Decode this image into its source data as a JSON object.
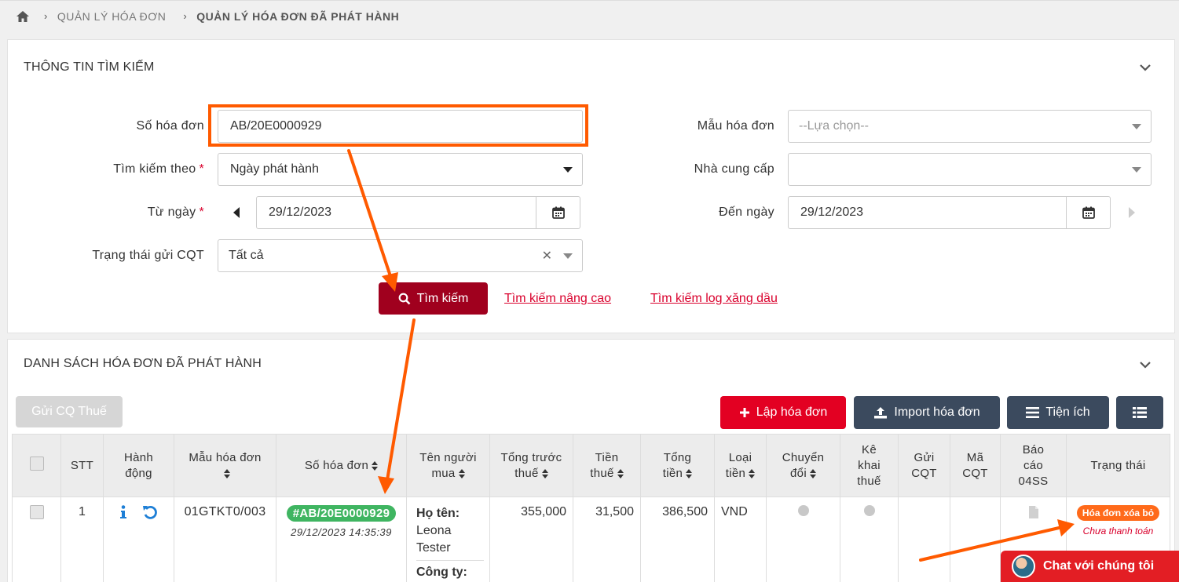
{
  "breadcrumb": {
    "items": [
      "QUẢN LÝ HÓA ĐƠN",
      "QUẢN LÝ HÓA ĐƠN ĐÃ PHÁT HÀNH"
    ]
  },
  "search_panel": {
    "title": "THÔNG TIN TÌM KIẾM",
    "invoice_number_label": "Số hóa đơn",
    "invoice_number_value": "AB/20E0000929",
    "search_by_label": "Tìm kiếm theo",
    "search_by_value": "Ngày phát hành",
    "from_date_label": "Từ ngày",
    "from_date_value": "29/12/2023",
    "status_label": "Trạng thái gửi CQT",
    "status_value": "Tất cả",
    "template_label": "Mẫu hóa đơn",
    "template_placeholder": "--Lựa chọn--",
    "supplier_label": "Nhà cung cấp",
    "supplier_value": "",
    "to_date_label": "Đến ngày",
    "to_date_value": "29/12/2023",
    "search_button": "Tìm kiếm",
    "advanced_search_link": "Tìm kiếm nâng cao",
    "fuel_log_link": "Tìm kiếm log xăng dầu",
    "required_mark": "*"
  },
  "list_panel": {
    "title": "DANH SÁCH HÓA ĐƠN ĐÃ PHÁT HÀNH",
    "send_tax_button": "Gửi CQ Thuế",
    "create_invoice_button": "Lập hóa đơn",
    "import_invoice_button": "Import hóa đơn",
    "utilities_button": "Tiện ích"
  },
  "table": {
    "headers": {
      "stt": "STT",
      "action": [
        "Hành",
        "động"
      ],
      "template": "Mẫu hóa đơn",
      "number": "Số hóa đơn",
      "buyer": [
        "Tên người",
        "mua"
      ],
      "pretax": [
        "Tổng trước",
        "thuế"
      ],
      "tax": [
        "Tiền",
        "thuế"
      ],
      "total": [
        "Tổng",
        "tiền"
      ],
      "currency": [
        "Loại",
        "tiền"
      ],
      "convert": [
        "Chuyển",
        "đổi"
      ],
      "declare": [
        "Kê",
        "khai",
        "thuế"
      ],
      "send": [
        "Gửi",
        "CQT"
      ],
      "code": [
        "Mã",
        "CQT"
      ],
      "report": [
        "Báo",
        "cáo",
        "04SS"
      ],
      "status": "Trạng thái"
    },
    "rows": [
      {
        "stt": "1",
        "template": "01GTKT0/003",
        "number": "#AB/20E0000929",
        "datetime": "29/12/2023 14:35:39",
        "buyer_name_label": "Họ tên:",
        "buyer_name": "Leona Tester",
        "company_label": "Công ty:",
        "pretax": "355,000",
        "tax": "31,500",
        "total": "386,500",
        "currency": "VND",
        "status_badge": "Hóa đơn xóa bỏ",
        "payment_status": "Chưa thanh toán"
      }
    ]
  },
  "chat": {
    "label": "Chat với chúng tôi"
  },
  "colors": {
    "highlight": "#ff5a00",
    "search_button": "#a0001e",
    "primary_red": "#e30022",
    "navy": "#3b4a5e",
    "badge_green": "#3fb561",
    "badge_orange": "#ff6a1a"
  }
}
